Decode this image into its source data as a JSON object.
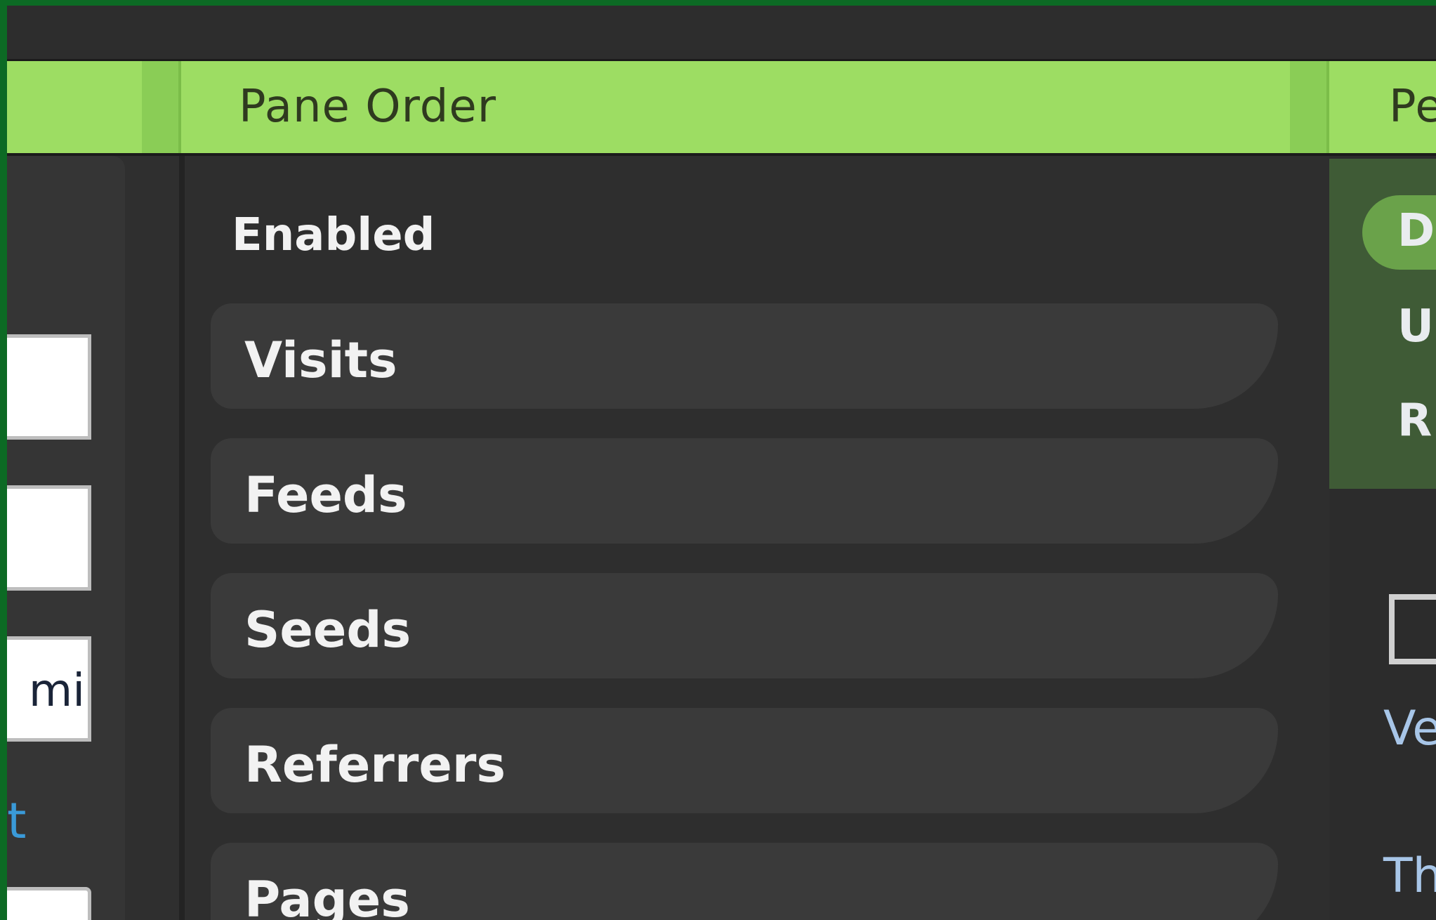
{
  "header": {
    "title": "Pane Order",
    "right_title_fragment": "Pe"
  },
  "middle": {
    "section_label": "Enabled",
    "panes": [
      "Visits",
      "Feeds",
      "Seeds",
      "Referrers",
      "Pages"
    ]
  },
  "left": {
    "input_fragment": "mi",
    "link_fragment": "t"
  },
  "right": {
    "options": [
      "D",
      "U",
      "R"
    ],
    "label_v": "Ve",
    "label_t": "Th"
  },
  "colors": {
    "header_bg": "#9ddd63",
    "app_bg": "#2e2e2e",
    "pane_row_bg": "#3a3a3a",
    "accent_green": "#6aa24a",
    "frame_green": "#0c6a24"
  }
}
